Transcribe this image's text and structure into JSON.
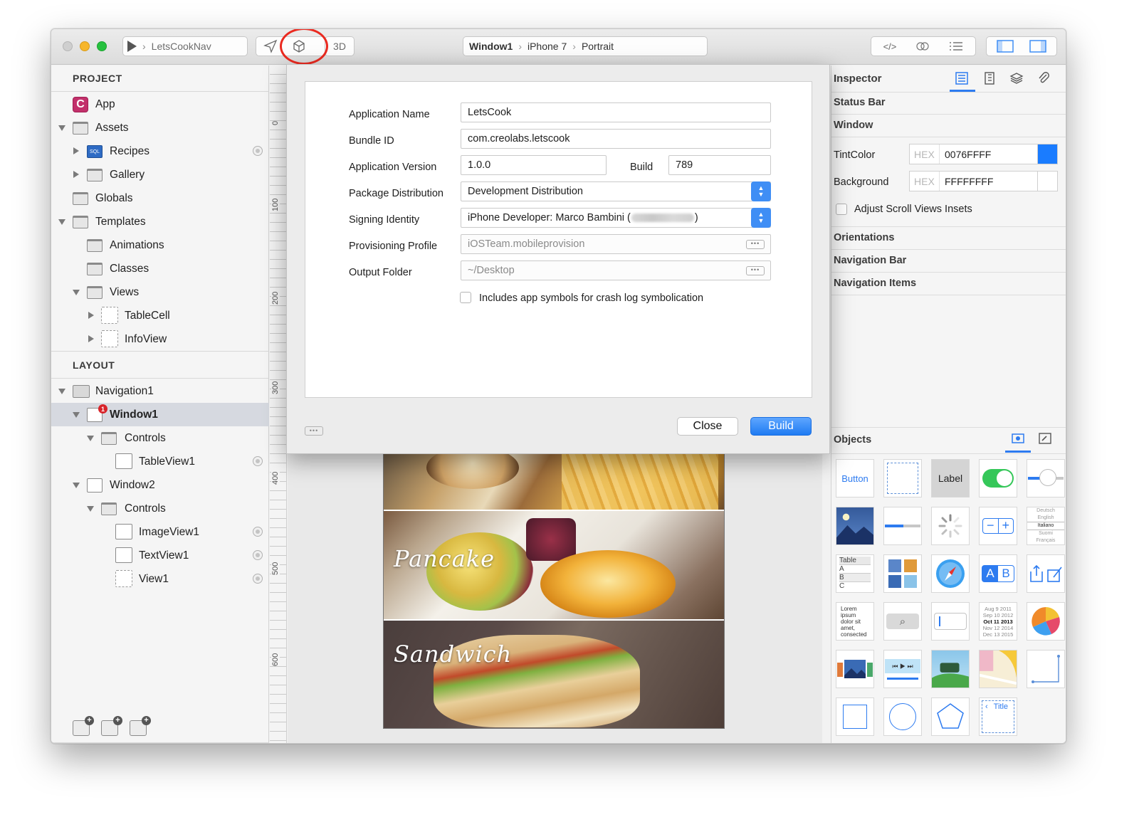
{
  "toolbar": {
    "scheme_name": "LetsCookNav",
    "threed_label": "3D",
    "breadcrumb": [
      "Window1",
      "iPhone 7",
      "Portrait"
    ]
  },
  "project": {
    "header": "PROJECT",
    "items": [
      {
        "label": "App"
      },
      {
        "label": "Assets"
      },
      {
        "label": "Recipes"
      },
      {
        "label": "Gallery"
      },
      {
        "label": "Globals"
      },
      {
        "label": "Templates"
      },
      {
        "label": "Animations"
      },
      {
        "label": "Classes"
      },
      {
        "label": "Views"
      },
      {
        "label": "TableCell"
      },
      {
        "label": "InfoView"
      }
    ]
  },
  "layout": {
    "header": "LAYOUT",
    "items": [
      {
        "label": "Navigation1"
      },
      {
        "label": "Window1",
        "badge": "1"
      },
      {
        "label": "Controls"
      },
      {
        "label": "TableView1"
      },
      {
        "label": "Window2"
      },
      {
        "label": "Controls"
      },
      {
        "label": "ImageView1"
      },
      {
        "label": "TextView1"
      },
      {
        "label": "View1"
      }
    ]
  },
  "ruler": {
    "marks": [
      "0",
      "100",
      "200",
      "300",
      "400",
      "500",
      "600"
    ]
  },
  "canvas": {
    "food_labels": [
      "Pancake",
      "Sandwich"
    ]
  },
  "dialog": {
    "app_name_label": "Application Name",
    "app_name": "LetsCook",
    "bundle_id_label": "Bundle ID",
    "bundle_id": "com.creolabs.letscook",
    "app_version_label": "Application Version",
    "app_version": "1.0.0",
    "build_label": "Build",
    "build": "789",
    "package_label": "Package Distribution",
    "package": "Development Distribution",
    "signing_label": "Signing Identity",
    "signing": "iPhone Developer: Marco Bambini (",
    "signing_end": ")",
    "profile_label": "Provisioning Profile",
    "profile": "iOSTeam.mobileprovision",
    "output_label": "Output Folder",
    "output": "~/Desktop",
    "symbols_label": "Includes app symbols for crash log symbolication",
    "close_button": "Close",
    "build_button": "Build"
  },
  "inspector": {
    "title": "Inspector",
    "status_bar": "Status Bar",
    "window": "Window",
    "tint_label": "TintColor",
    "hex_prefix": "HEX",
    "tint_value": "0076FFFF",
    "background_label": "Background",
    "background_value": "FFFFFFFF",
    "adjust_label": "Adjust Scroll Views Insets",
    "orientations": "Orientations",
    "navigation_bar": "Navigation Bar",
    "navigation_items": "Navigation Items",
    "tint_color": "#1a7cff",
    "background_color": "#ffffff"
  },
  "objects": {
    "title": "Objects",
    "button_label": "Button",
    "label_label": "Label",
    "table_label": "Table",
    "table_rows": [
      "A",
      "B",
      "C"
    ],
    "picker_langs": [
      "Deutsch",
      "English",
      "Italiano",
      "Suomi",
      "Français"
    ],
    "ab_label": "AB",
    "lorem": "Lorem ipsum dolor sit amet, consected",
    "date_rows": [
      "Aug  9  2011",
      "Sep 10 2012",
      "Oct  11  2013",
      "Nov 12 2014",
      "Dec 13 2015"
    ],
    "title_label": "Title"
  }
}
